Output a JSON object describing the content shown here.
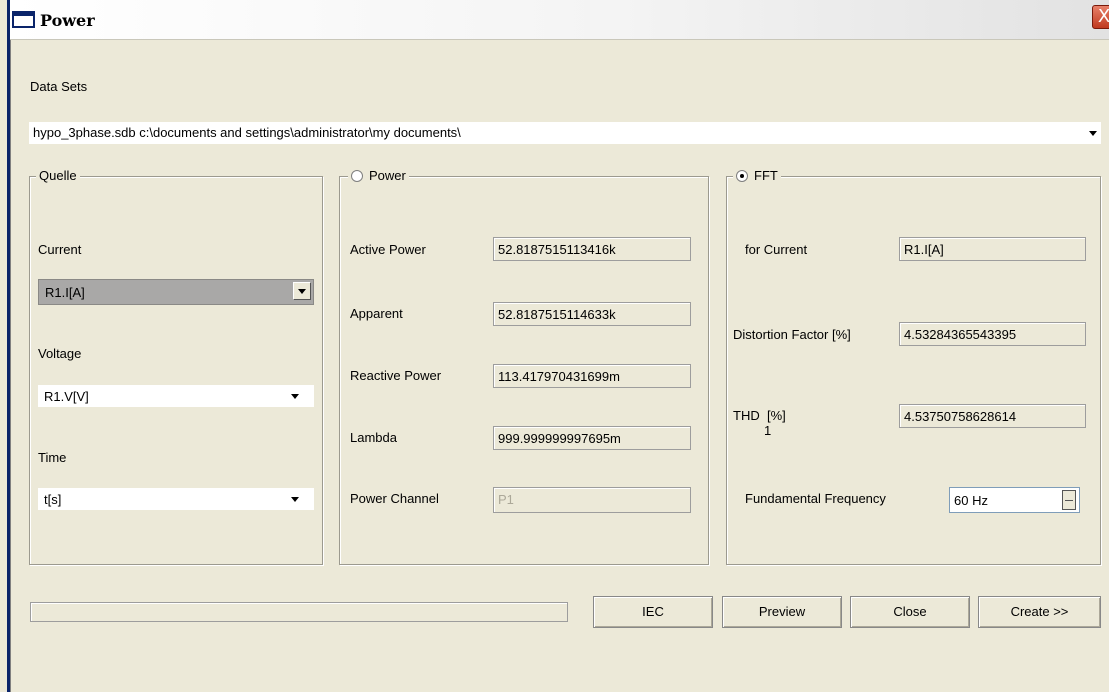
{
  "window": {
    "title": "Power",
    "close_label": "X"
  },
  "datasets": {
    "label": "Data Sets",
    "value": "hypo_3phase.sdb c:\\documents and settings\\administrator\\my documents\\"
  },
  "quelle": {
    "legend": "Quelle",
    "current_label": "Current",
    "current_value": "R1.I[A]",
    "voltage_label": "Voltage",
    "voltage_value": "R1.V[V]",
    "time_label": "Time",
    "time_value": "t[s]"
  },
  "power": {
    "legend": "Power",
    "selected": false,
    "active_label": "Active Power",
    "active_value": "52.8187515113416k",
    "apparent_label": "Apparent",
    "apparent_value": "52.8187515114633k",
    "reactive_label": "Reactive Power",
    "reactive_value": "113.417970431699m",
    "lambda_label": "Lambda",
    "lambda_value": "999.999999997695m",
    "channel_label": "Power Channel",
    "channel_value": "P1"
  },
  "fft": {
    "legend": "FFT",
    "selected": true,
    "for_current_label": "for Current",
    "for_current_value": "R1.I[A]",
    "distortion_label": "Distortion Factor [%]",
    "distortion_value": "4.53284365543395",
    "thd_label": "THD",
    "thd_subscript": "1",
    "thd_unit": "[%]",
    "thd_value": "4.53750758628614",
    "freq_label": "Fundamental Frequency",
    "freq_value": "60 Hz"
  },
  "progress": {
    "fraction": 0
  },
  "buttons": {
    "iec": "IEC",
    "preview": "Preview",
    "close": "Close",
    "create": "Create >>"
  }
}
